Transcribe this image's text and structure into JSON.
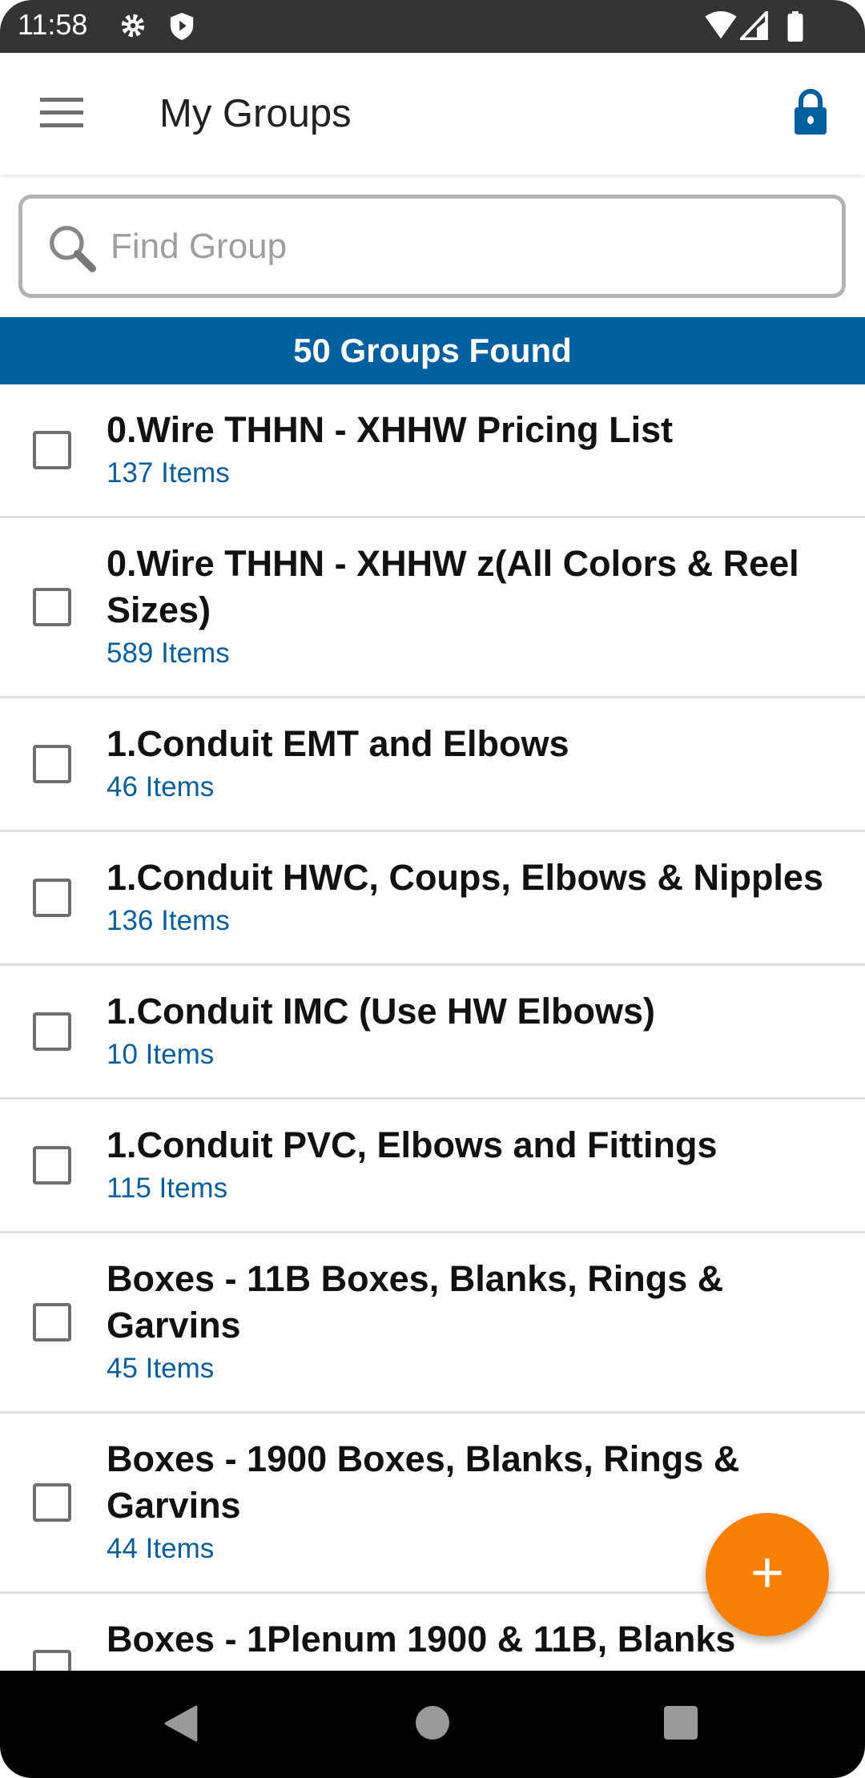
{
  "status_bar": {
    "time": "11:58",
    "icons": [
      "gear-icon",
      "shield-icon",
      "wifi-icon",
      "signal-icon",
      "battery-icon"
    ]
  },
  "app_bar": {
    "title": "My Groups",
    "menu_icon": "hamburger-icon",
    "action_icon": "lock-icon"
  },
  "search": {
    "placeholder": "Find Group",
    "value": ""
  },
  "banner": {
    "text": "50 Groups Found"
  },
  "groups": [
    {
      "name": "0.Wire THHN - XHHW Pricing List",
      "count": "137 Items"
    },
    {
      "name": "0.Wire THHN - XHHW z(All Colors & Reel Sizes)",
      "count": "589 Items"
    },
    {
      "name": "1.Conduit EMT and Elbows",
      "count": "46 Items"
    },
    {
      "name": "1.Conduit HWC, Coups, Elbows & Nipples",
      "count": "136 Items"
    },
    {
      "name": "1.Conduit IMC (Use HW Elbows)",
      "count": "10 Items"
    },
    {
      "name": "1.Conduit PVC, Elbows and Fittings",
      "count": "115 Items"
    },
    {
      "name": "Boxes - 11B Boxes, Blanks, Rings & Garvins",
      "count": "45 Items"
    },
    {
      "name": "Boxes - 1900 Boxes, Blanks, Rings & Garvins",
      "count": "44 Items"
    },
    {
      "name": "Boxes - 1Plenum 1900 & 11B, Blanks",
      "count": ""
    }
  ],
  "fab": {
    "label": "+"
  },
  "colors": {
    "primary": "#005f9e",
    "accent": "#f98006",
    "link": "#0a5e9c"
  }
}
